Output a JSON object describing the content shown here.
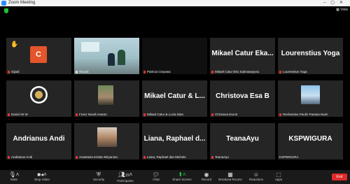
{
  "window": {
    "title": "Zoom Meeting",
    "view_label": "View"
  },
  "tiles": [
    {
      "name": "Gijadi",
      "big": "",
      "avatar_letter": "C"
    },
    {
      "name": "Wiyadi",
      "big": ""
    },
    {
      "name": "Patricia Cinyawa",
      "big": ""
    },
    {
      "name": "Mikael Catur Eko Sukmawiyoso",
      "big": "Mikael Catur Eka..."
    },
    {
      "name": "Lourenstius Yoga",
      "big": "Lourenstius Yoga"
    },
    {
      "name": "Daniel W W",
      "big": ""
    },
    {
      "name": "Franz Nundi Ananto",
      "big": ""
    },
    {
      "name": "Mikael Catur & Lucia Dian",
      "big": "Mikael Catur & L..."
    },
    {
      "name": "Christova Esa B",
      "big": "Christova Esa B"
    },
    {
      "name": "Rechentius Paulin Panasa Naim",
      "big": ""
    },
    {
      "name": "Andrianus Andi",
      "big": "Andrianus Andi"
    },
    {
      "name": "Anastasia Kristia Wiryanoto",
      "big": ""
    },
    {
      "name": "Liana, Raphael dan Michele",
      "big": "Liana, Raphael d..."
    },
    {
      "name": "TeanaAyu",
      "big": "TeanaAyu"
    },
    {
      "name": "KSPWIGURA",
      "big": "KSPWIGURA"
    }
  ],
  "toolbar": {
    "mute": "Mute",
    "stop_video": "Stop Video",
    "security": "Security",
    "participants": "Participants",
    "participants_count": "15",
    "chat": "Chat",
    "share_screen": "Share Screen",
    "record": "Record",
    "breakout": "Breakout Rooms",
    "reactions": "Reactions",
    "apps": "Apps",
    "end": "End"
  }
}
